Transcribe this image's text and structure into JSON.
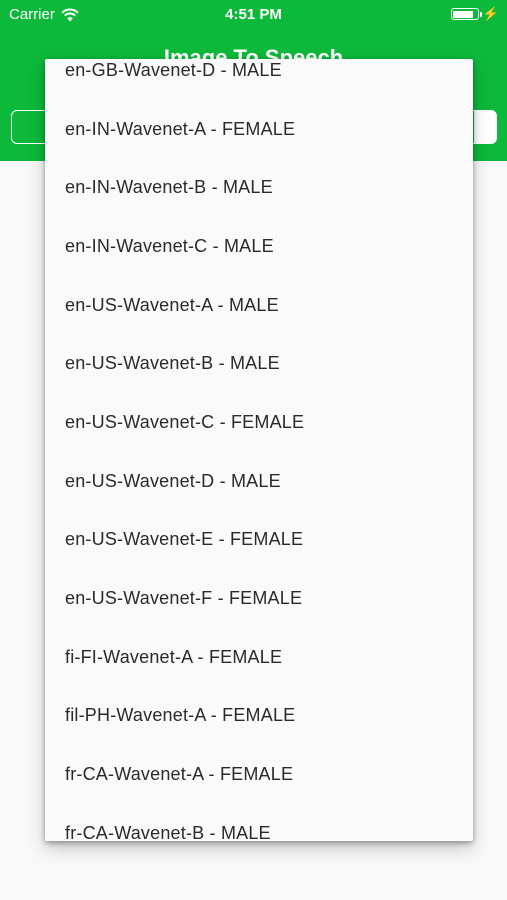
{
  "status_bar": {
    "carrier": "Carrier",
    "time": "4:51 PM"
  },
  "header": {
    "title": "Image To Speech",
    "color": "#0cb93a"
  },
  "voice_dropdown": {
    "options": [
      "en-GB-Wavenet-D - MALE",
      "en-IN-Wavenet-A - FEMALE",
      "en-IN-Wavenet-B - MALE",
      "en-IN-Wavenet-C - MALE",
      "en-US-Wavenet-A - MALE",
      "en-US-Wavenet-B - MALE",
      "en-US-Wavenet-C - FEMALE",
      "en-US-Wavenet-D - MALE",
      "en-US-Wavenet-E - FEMALE",
      "en-US-Wavenet-F - FEMALE",
      "fi-FI-Wavenet-A - FEMALE",
      "fil-PH-Wavenet-A - FEMALE",
      "fr-CA-Wavenet-A - FEMALE",
      "fr-CA-Wavenet-B - MALE"
    ]
  }
}
